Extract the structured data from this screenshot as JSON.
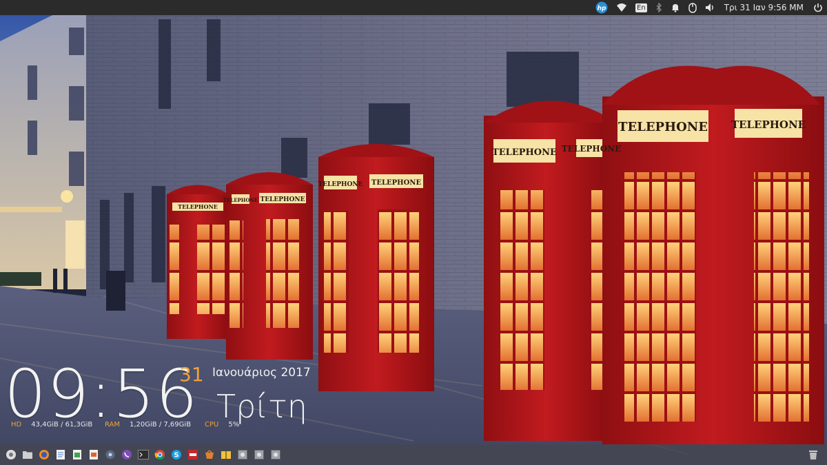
{
  "top_panel": {
    "indicators": [
      "hp-icon",
      "wifi-icon",
      "keyboard-layout-indicator",
      "bluetooth-icon",
      "notifications-icon",
      "mouse-icon",
      "volume-icon"
    ],
    "keyboard_layout": "En",
    "datetime": "Τρι 31 Ιαν  9:56 MM"
  },
  "clock_widget": {
    "time": "09:56",
    "day": "31",
    "month_year": "Ιανουάριος 2017",
    "weekday": "Τρίτη"
  },
  "system_stats": {
    "hd_label": "HD",
    "hd_value": "43,4GiB / 61,3GiB",
    "ram_label": "RAM",
    "ram_value": "1,20GiB / 7,69GiB",
    "cpu_label": "CPU",
    "cpu_value": "5%"
  },
  "dock": {
    "apps": [
      "system-settings-icon",
      "files-icon",
      "firefox-icon",
      "text-document-icon",
      "spreadsheet-icon",
      "presentation-icon",
      "settings-gear-icon",
      "viber-icon",
      "terminal-icon",
      "chrome-icon",
      "skype-icon",
      "pdf-viewer-icon",
      "software-center-icon",
      "archive-icon",
      "drive-icon-1",
      "drive-icon-2",
      "drive-icon-3"
    ],
    "trash": "trash-icon"
  },
  "colors": {
    "accent": "#f0a23a",
    "phone_box_red": "#b3161a",
    "panel_bg": "#2b2b2b"
  },
  "wallpaper": {
    "booth_signs": [
      "TELEPHONE",
      "TELEPHONE",
      "TELEPHONE",
      "TELEPHONE",
      "TELEPHONE",
      "TELEPHONE",
      "TELEPHONE",
      "TELEPHONE",
      "TELEPHONE",
      "TELEPHONE"
    ]
  }
}
